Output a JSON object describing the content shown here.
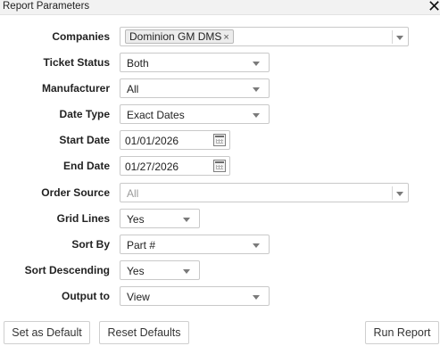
{
  "dialog": {
    "title": "Report Parameters"
  },
  "fields": {
    "companies": {
      "label": "Companies",
      "tag": "Dominion GM DMS",
      "tag_remove": "×"
    },
    "ticket_status": {
      "label": "Ticket Status",
      "value": "Both"
    },
    "manufacturer": {
      "label": "Manufacturer",
      "value": "All"
    },
    "date_type": {
      "label": "Date Type",
      "value": "Exact Dates"
    },
    "start_date": {
      "label": "Start Date",
      "value": "01/01/2026"
    },
    "end_date": {
      "label": "End Date",
      "value": "01/27/2026"
    },
    "order_source": {
      "label": "Order Source",
      "value": "All"
    },
    "grid_lines": {
      "label": "Grid Lines",
      "value": "Yes"
    },
    "sort_by": {
      "label": "Sort By",
      "value": "Part #"
    },
    "sort_descending": {
      "label": "Sort Descending",
      "value": "Yes"
    },
    "output_to": {
      "label": "Output to",
      "value": "View"
    }
  },
  "buttons": {
    "set_default": "Set as Default",
    "reset_defaults": "Reset Defaults",
    "run_report": "Run Report"
  },
  "icons": {
    "close": "close-icon",
    "dropdown": "chevron-down-icon",
    "calendar": "calendar-icon"
  },
  "colors": {
    "titlebar_bg": "#f2f2f2",
    "field_border": "#c9c9c9",
    "tag_bg": "#ececec",
    "disabled_text": "#9a9a9a"
  }
}
